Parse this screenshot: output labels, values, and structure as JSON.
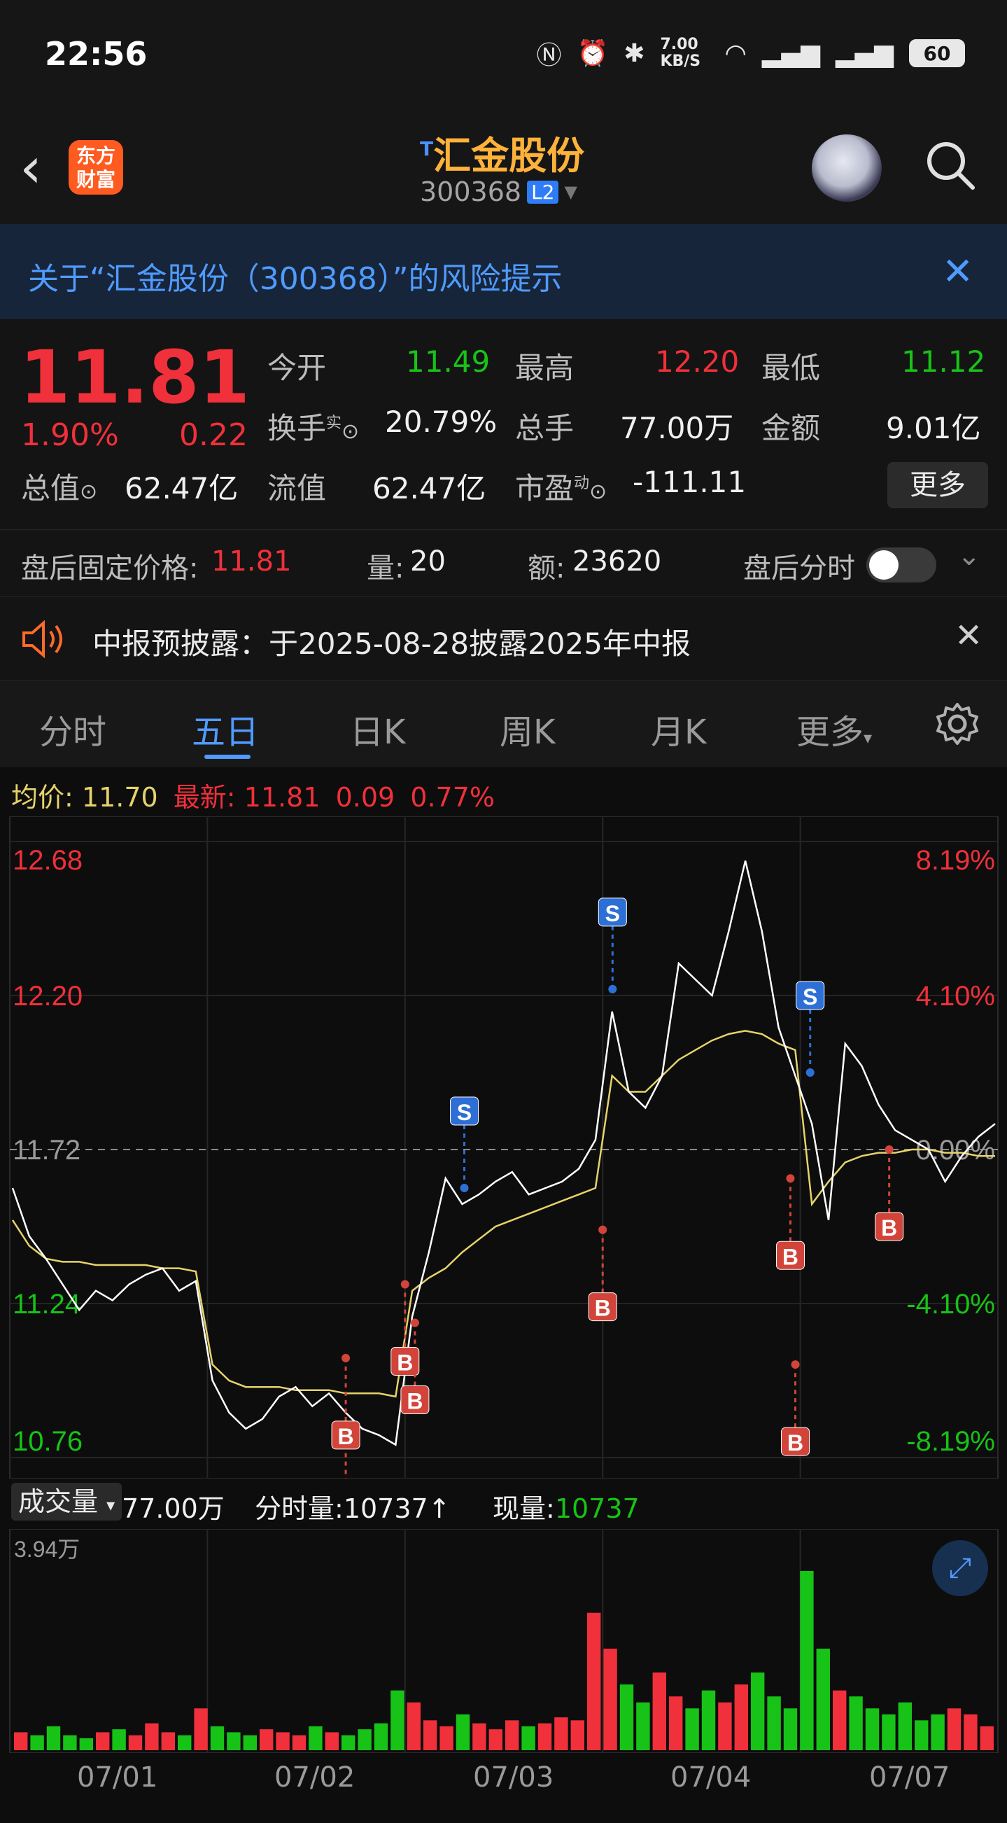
{
  "status_bar": {
    "time": "22:56",
    "net_speed": "7.00 KB/S",
    "battery": "60"
  },
  "header": {
    "title": "汇金股份",
    "title_mark": "T",
    "code": "300368",
    "level": "L2",
    "logo_text_1": "东方",
    "logo_text_2": "财富"
  },
  "risk_banner": {
    "text": "关于“汇金股份（300368）”的风险提示"
  },
  "quote": {
    "price": "11.81",
    "change_pct": "1.90%",
    "change": "0.22",
    "open_label": "今开",
    "open": "11.49",
    "high_label": "最高",
    "high": "12.20",
    "low_label": "最低",
    "low": "11.12",
    "turnover_label": "换手",
    "turnover_sup": "实",
    "turnover": "20.79%",
    "volume_label": "总手",
    "volume": "77.00万",
    "amount_label": "金额",
    "amount": "9.01亿",
    "mktcap_label": "总值",
    "mktcap": "62.47亿",
    "float_label": "流值",
    "float": "62.47亿",
    "pe_label": "市盈",
    "pe_sup": "动",
    "pe": "-111.11",
    "more": "更多"
  },
  "after_hours": {
    "price_label": "盘后固定价格:",
    "price": "11.81",
    "vol_label": "量:",
    "vol": "20",
    "amt_label": "额:",
    "amt": "23620",
    "toggle_label": "盘后分时"
  },
  "notice": {
    "text": "中报预披露：于2025-08-28披露2025年中报"
  },
  "tabs": [
    "分时",
    "五日",
    "日K",
    "周K",
    "月K",
    "更多"
  ],
  "active_tab": 1,
  "avg_bar": {
    "avg_label": "均价:",
    "avg": "11.70",
    "latest_label": "最新:",
    "latest": "11.81",
    "chg": "0.09",
    "pct": "0.77%"
  },
  "volume_bar": {
    "button": "成交量",
    "total": "77.00万",
    "tick_label": "分时量:",
    "tick": "10737↑",
    "now_label": "现量:",
    "now": "10737"
  },
  "colors": {
    "up": "#f0303a",
    "down": "#17c317",
    "accent": "#4f9bff",
    "avg_line": "#e6d36a",
    "price_line": "#ffffff"
  },
  "chart_data": {
    "type": "line",
    "title": "",
    "days": [
      "07/01",
      "07/02",
      "07/03",
      "07/04",
      "07/07"
    ],
    "y_ticks_left": [
      "12.68",
      "12.20",
      "11.72",
      "11.24",
      "10.76"
    ],
    "y_ticks_right": [
      "8.19%",
      "4.10%",
      "0.00%",
      "-4.10%",
      "-8.19%"
    ],
    "ylim": [
      10.76,
      12.68
    ],
    "prev_close": 11.72,
    "vol_max_label": "3.94万",
    "series": [
      {
        "values": [
          11.6,
          11.45,
          11.38,
          11.3,
          11.22,
          11.28,
          11.25,
          11.3,
          11.33,
          11.35,
          11.28,
          11.31,
          11.0,
          10.9,
          10.85,
          10.88,
          10.95,
          10.98,
          10.92,
          10.96,
          10.9,
          10.85,
          10.83,
          10.8,
          11.2,
          11.4,
          11.63,
          11.55,
          11.58,
          11.62,
          11.65,
          11.58,
          11.6,
          11.62,
          11.66,
          11.75,
          12.15,
          11.9,
          11.85,
          11.95,
          12.3,
          12.25,
          12.2,
          12.4,
          12.62,
          12.4,
          12.1,
          11.95,
          11.8,
          11.5,
          12.05,
          11.98,
          11.86,
          11.78,
          11.75,
          11.72,
          11.62,
          11.7,
          11.76,
          11.8
        ]
      },
      {
        "values": [
          11.5,
          11.42,
          11.38,
          11.37,
          11.37,
          11.36,
          11.36,
          11.36,
          11.36,
          11.35,
          11.35,
          11.34,
          11.05,
          11.0,
          10.98,
          10.98,
          10.98,
          10.97,
          10.97,
          10.97,
          10.96,
          10.96,
          10.96,
          10.95,
          11.28,
          11.32,
          11.35,
          11.4,
          11.44,
          11.48,
          11.5,
          11.52,
          11.54,
          11.56,
          11.58,
          11.6,
          11.95,
          11.9,
          11.9,
          11.95,
          12.0,
          12.03,
          12.06,
          12.08,
          12.09,
          12.08,
          12.05,
          12.03,
          11.55,
          11.62,
          11.68,
          11.7,
          11.71,
          11.71,
          11.72,
          11.72,
          11.71,
          11.71,
          11.7,
          11.7
        ]
      }
    ],
    "signals": [
      {
        "label": "S",
        "value": 11.6
      },
      {
        "label": "S",
        "value": 12.22
      },
      {
        "label": "S",
        "value": 11.96
      },
      {
        "label": "B",
        "value": 10.8
      },
      {
        "label": "B",
        "value": 11.07
      },
      {
        "label": "B",
        "value": 11.3
      },
      {
        "label": "B",
        "value": 11.18
      },
      {
        "label": "B",
        "value": 11.47
      },
      {
        "label": "B",
        "value": 11.63
      },
      {
        "label": "B",
        "value": 11.05
      },
      {
        "label": "B",
        "value": 11.72
      }
    ],
    "volume": [
      6,
      5,
      8,
      5,
      4,
      6,
      7,
      5,
      9,
      6,
      5,
      14,
      8,
      6,
      5,
      7,
      6,
      5,
      8,
      6,
      5,
      7,
      9,
      20,
      16,
      10,
      8,
      12,
      9,
      7,
      10,
      8,
      9,
      11,
      10,
      46,
      34,
      22,
      16,
      26,
      18,
      14,
      20,
      16,
      22,
      26,
      18,
      14,
      60,
      34,
      20,
      18,
      14,
      12,
      16,
      10,
      12,
      14,
      12,
      8
    ]
  }
}
